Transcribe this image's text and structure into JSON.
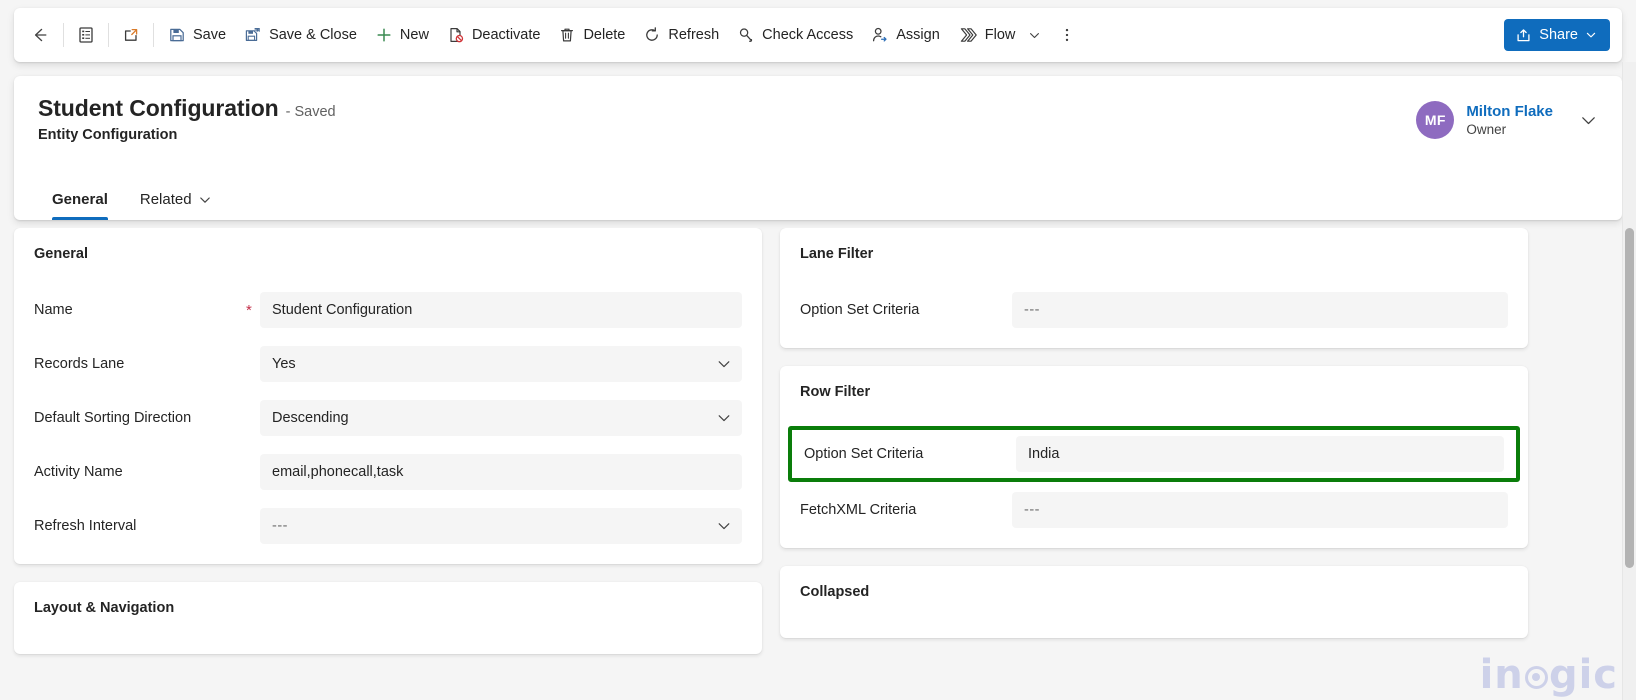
{
  "commandbar": {
    "back_label": "Back",
    "form_selector_label": "Form selector",
    "popout_label": "Open in new window",
    "buttons": [
      {
        "id": "save",
        "label": "Save",
        "icon": "save-icon"
      },
      {
        "id": "save-close",
        "label": "Save & Close",
        "icon": "save-and-close-icon"
      },
      {
        "id": "new",
        "label": "New",
        "icon": "plus-icon"
      },
      {
        "id": "deactivate",
        "label": "Deactivate",
        "icon": "deactivate-icon"
      },
      {
        "id": "delete",
        "label": "Delete",
        "icon": "trash-icon"
      },
      {
        "id": "refresh",
        "label": "Refresh",
        "icon": "refresh-icon"
      },
      {
        "id": "check-access",
        "label": "Check Access",
        "icon": "key-icon"
      },
      {
        "id": "assign",
        "label": "Assign",
        "icon": "person-assign-icon"
      },
      {
        "id": "flow",
        "label": "Flow",
        "icon": "flow-icon"
      }
    ],
    "overflow_label": "More commands",
    "share_label": "Share"
  },
  "header": {
    "title": "Student Configuration",
    "saved_status": "- Saved",
    "subtitle": "Entity Configuration",
    "tabs": [
      {
        "id": "general",
        "label": "General",
        "active": true,
        "has_chevron": false
      },
      {
        "id": "related",
        "label": "Related",
        "active": false,
        "has_chevron": true
      }
    ],
    "owner": {
      "initials": "MF",
      "name": "Milton Flake",
      "role": "Owner",
      "avatar_color": "#8e6bc0"
    }
  },
  "sections": {
    "general": {
      "title": "General",
      "fields": [
        {
          "label": "Name",
          "value": "Student Configuration",
          "type": "text",
          "required": true
        },
        {
          "label": "Records Lane",
          "value": "Yes",
          "type": "select",
          "required": false
        },
        {
          "label": "Default Sorting Direction",
          "value": "Descending",
          "type": "select",
          "required": false
        },
        {
          "label": "Activity Name",
          "value": "email,phonecall,task",
          "type": "text",
          "required": false
        },
        {
          "label": "Refresh Interval",
          "value": "---",
          "type": "select",
          "required": false,
          "empty": true
        }
      ]
    },
    "layout_navigation": {
      "title": "Layout & Navigation"
    },
    "lane_filter": {
      "title": "Lane Filter",
      "fields": [
        {
          "label": "Option Set Criteria",
          "value": "---",
          "type": "text",
          "required": false,
          "empty": true
        }
      ]
    },
    "row_filter": {
      "title": "Row Filter",
      "fields": [
        {
          "label": "Option Set Criteria",
          "value": "India",
          "type": "text",
          "required": false,
          "highlighted": true
        },
        {
          "label": "FetchXML Criteria",
          "value": "---",
          "type": "text",
          "required": false,
          "empty": true
        }
      ]
    },
    "collapsed": {
      "title": "Collapsed"
    }
  },
  "watermark": {
    "text_before": "in",
    "text_after": "gic"
  },
  "colors": {
    "accent_blue": "#0f6cbd",
    "highlight_green": "#0a7d0a",
    "required_red": "#c4314b",
    "avatar_purple": "#8e6bc0",
    "watermark": "#c7cbe8"
  }
}
